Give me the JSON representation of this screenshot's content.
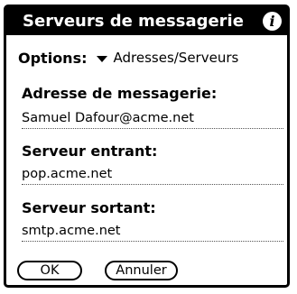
{
  "dialog": {
    "title": "Serveurs de messagerie",
    "info_icon": "info-icon"
  },
  "options": {
    "label": "Options:",
    "selected": "Adresses/Serveurs",
    "arrow_icon": "triangle-down-icon"
  },
  "fields": {
    "email_label": "Adresse de messagerie:",
    "email_value": "Samuel Dafour@acme.net",
    "incoming_label": "Serveur entrant:",
    "incoming_value": "pop.acme.net",
    "outgoing_label": "Serveur sortant:",
    "outgoing_value": "smtp.acme.net"
  },
  "buttons": {
    "ok": "OK",
    "cancel": "Annuler"
  }
}
